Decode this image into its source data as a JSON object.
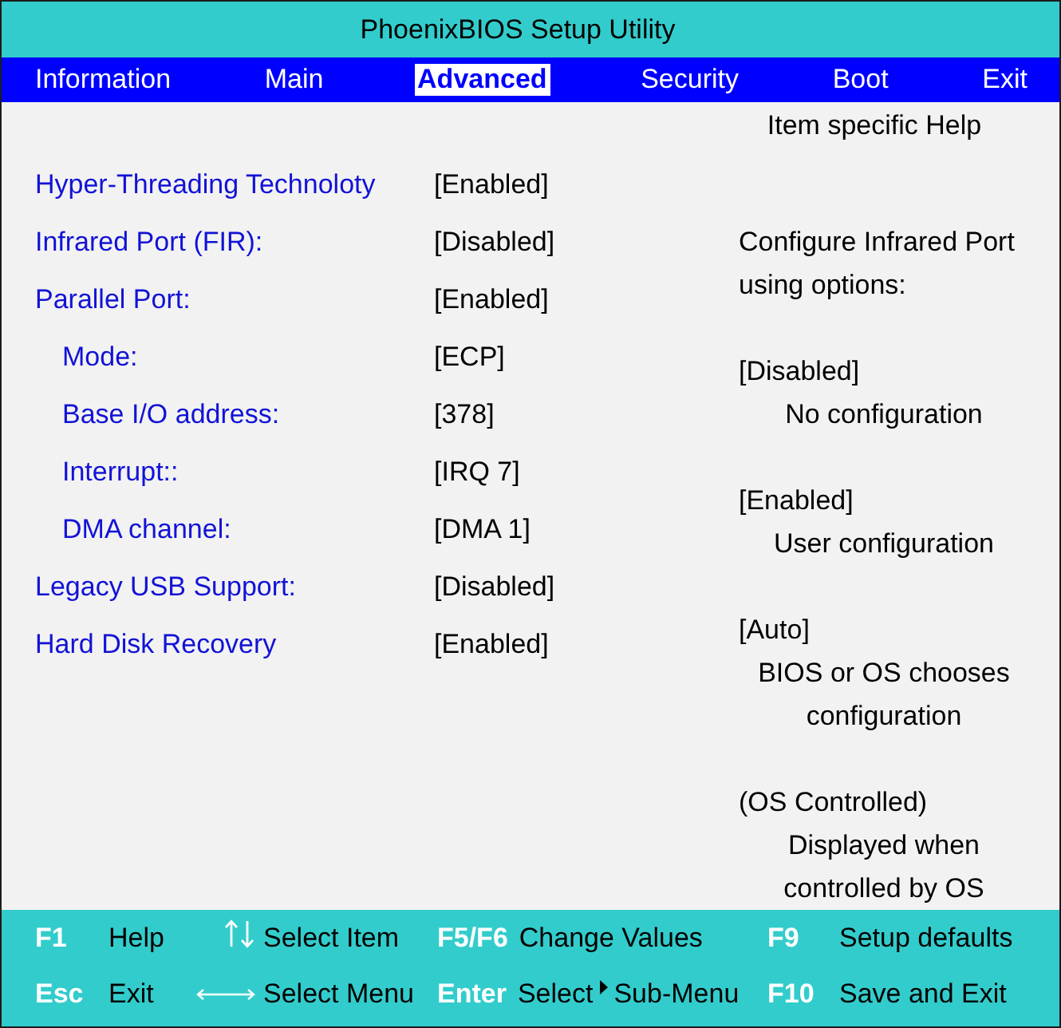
{
  "title": "PhoenixBIOS Setup Utility",
  "menu": [
    {
      "label": "Information",
      "selected": false
    },
    {
      "label": "Main",
      "selected": false
    },
    {
      "label": "Advanced",
      "selected": true
    },
    {
      "label": "Security",
      "selected": false
    },
    {
      "label": "Boot",
      "selected": false
    },
    {
      "label": "Exit",
      "selected": false
    }
  ],
  "settings": [
    {
      "label": "Hyper-Threading Technoloty",
      "value": "[Enabled]"
    },
    {
      "label": "Infrared Port (FIR):",
      "value": "[Disabled]"
    },
    {
      "label": "Parallel Port:",
      "value": "[Enabled]",
      "children": [
        {
          "label": "Mode:",
          "value": "[ECP]"
        },
        {
          "label": "Base I/O address:",
          "value": "[378]"
        },
        {
          "label": "Interrupt::",
          "value": "[IRQ 7]"
        },
        {
          "label": "DMA channel:",
          "value": "[DMA 1]"
        }
      ]
    },
    {
      "label": "Legacy USB Support:",
      "value": "[Disabled]"
    },
    {
      "label": "Hard Disk Recovery",
      "value": "[Enabled]"
    }
  ],
  "help": {
    "title": "Item specific Help",
    "intro": "Configure Infrared Port using options:",
    "options": [
      {
        "option": "[Disabled]",
        "description": "No configuration"
      },
      {
        "option": "[Enabled]",
        "description": "User configuration"
      },
      {
        "option": "[Auto]",
        "description": "BIOS or OS chooses configuration"
      },
      {
        "option": "(OS Controlled)",
        "description": "Displayed when controlled by OS"
      }
    ]
  },
  "status_bar": {
    "rows": [
      {
        "items": [
          {
            "kind": "key",
            "key": "F1",
            "action": "Help"
          },
          {
            "kind": "arrows",
            "action": "Select Item"
          },
          {
            "kind": "key",
            "key": "F5/F6",
            "action": "Change Values"
          },
          {
            "kind": "key",
            "key": "F9",
            "action": "Setup defaults"
          }
        ]
      },
      {
        "items": [
          {
            "kind": "key",
            "key": "Esc",
            "action": "Exit"
          },
          {
            "kind": "arrows",
            "action": "Select Menu"
          },
          {
            "kind": "key",
            "key": "Enter",
            "action": "Select",
            "target": "Sub-Menu"
          },
          {
            "kind": "key",
            "key": "F10",
            "action": "Save and Exit"
          }
        ]
      }
    ]
  }
}
